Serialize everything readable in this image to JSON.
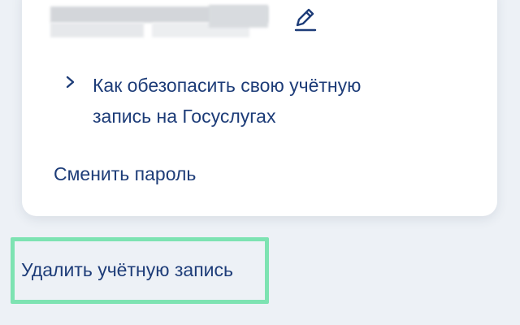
{
  "profile": {
    "edit_icon": "pencil-icon"
  },
  "links": {
    "security_chevron": "chevron-right-icon",
    "security_line1": "Как обезопасить свою учётную",
    "security_line2": "запись на Госуслугах",
    "change_password": "Сменить пароль",
    "delete_account": "Удалить учётную запись"
  },
  "colors": {
    "background": "#edf1f6",
    "card": "#ffffff",
    "link": "#1d3c78",
    "highlight": "#7de3b2",
    "blur": "#cfd3d8"
  }
}
